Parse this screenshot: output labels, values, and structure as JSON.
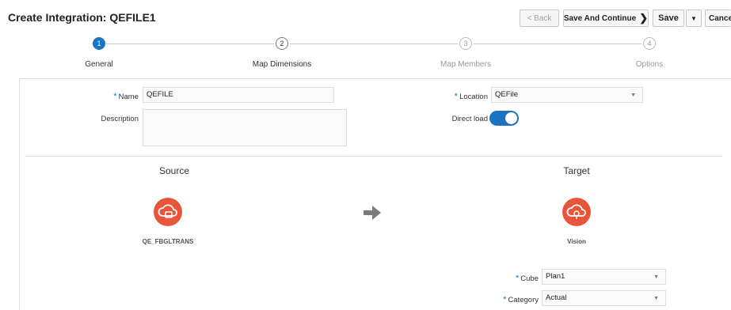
{
  "header": {
    "title": "Create Integration: QEFILE1"
  },
  "toolbar": {
    "back_label": "< Back",
    "save_continue_label": "Save And Continue",
    "save_label": "Save",
    "cancel_label": "Cance"
  },
  "steps": [
    {
      "number": "1",
      "label": "General"
    },
    {
      "number": "2",
      "label": "Map Dimensions"
    },
    {
      "number": "3",
      "label": "Map Members"
    },
    {
      "number": "4",
      "label": "Options"
    }
  ],
  "form": {
    "name_label": "Name",
    "name_value": "QEFILE",
    "description_label": "Description",
    "description_value": "",
    "location_label": "Location",
    "location_value": "QEFile",
    "direct_load_label": "Direct load"
  },
  "source": {
    "title": "Source",
    "app_name": "QE_FBGLTRANS"
  },
  "target": {
    "title": "Target",
    "app_name": "Vision"
  },
  "target_fields": {
    "cube_label": "Cube",
    "cube_value": "Plan1",
    "category_label": "Category",
    "category_value": "Actual"
  },
  "colors": {
    "accent": "#1b73c2",
    "app_icon": "#e8553a"
  }
}
